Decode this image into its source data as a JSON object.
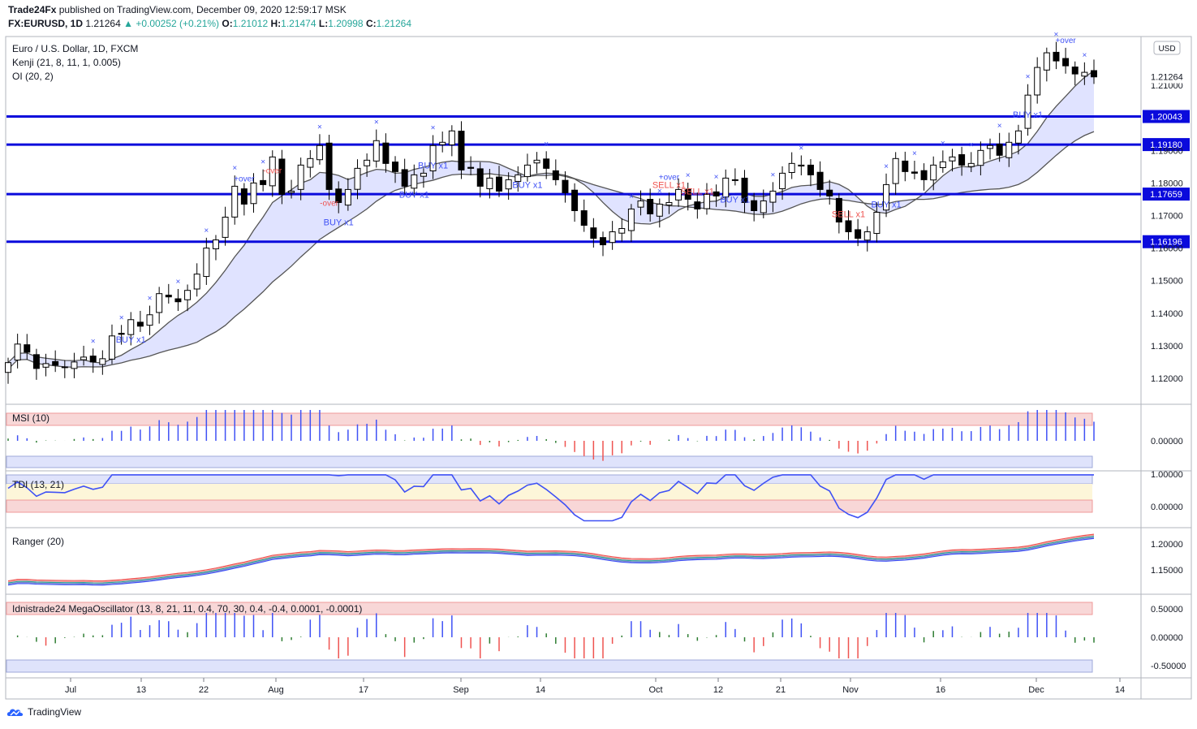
{
  "header": {
    "publisher": "Trade24Fx",
    "published_text": "published on TradingView.com, December 09, 2020 12:59:17 MSK",
    "symbol": "FX:EURUSD, 1D",
    "price": "1.21264",
    "change": "+0.00252 (+0.21%)",
    "open_label": "O:",
    "open": "1.21012",
    "high_label": "H:",
    "high": "1.21474",
    "low_label": "L:",
    "low": "1.20998",
    "close_label": "C:",
    "close": "1.21264"
  },
  "legend": {
    "title": "Euro / U.S. Dollar, 1D, FXCM",
    "line2": "Kenji (21, 8, 11, 1, 0.005)",
    "line3": "OI (20, 2)"
  },
  "footer": {
    "brand": "TradingView"
  },
  "colors": {
    "bull": "#ffffff",
    "bear": "#000000",
    "hline": "#0a0adc",
    "cloud_up": "#dff3d6",
    "cloud_dn": "#f7dede",
    "band": "#d8dcff",
    "signal_blue": "#3f51f5",
    "signal_red": "#ef5350"
  },
  "chart_data": [
    {
      "type": "candlestick",
      "title": "Euro / U.S. Dollar, 1D, FXCM",
      "currency": "USD",
      "ylim": [
        1.112,
        1.225
      ],
      "yticks": [
        "1.12000",
        "1.13000",
        "1.14000",
        "1.15000",
        "1.16000",
        "1.17000",
        "1.18000",
        "1.19000",
        "1.21000"
      ],
      "x_tick_labels": [
        "Jul",
        "13",
        "22",
        "Aug",
        "17",
        "Sep",
        "14",
        "Oct",
        "12",
        "21",
        "Nov",
        "16",
        "Dec",
        "14"
      ],
      "levels": [
        {
          "value": 1.20043,
          "label": "1.20043"
        },
        {
          "value": 1.1918,
          "label": "1.19180"
        },
        {
          "value": 1.17659,
          "label": "1.17659"
        },
        {
          "value": 1.16196,
          "label": "1.16196"
        }
      ],
      "last_price": "1.21264",
      "closes": [
        1.1248,
        1.1305,
        1.128,
        1.123,
        1.1245,
        1.124,
        1.1235,
        1.125,
        1.1265,
        1.125,
        1.126,
        1.133,
        1.1335,
        1.138,
        1.136,
        1.1395,
        1.146,
        1.145,
        1.1435,
        1.147,
        1.152,
        1.16,
        1.1625,
        1.1695,
        1.179,
        1.1735,
        1.18,
        1.1795,
        1.188,
        1.1765,
        1.1775,
        1.1855,
        1.1875,
        1.1915,
        1.178,
        1.174,
        1.178,
        1.1845,
        1.187,
        1.193,
        1.186,
        1.1835,
        1.179,
        1.1825,
        1.183,
        1.1915,
        1.1925,
        1.196,
        1.184,
        1.1845,
        1.179,
        1.1815,
        1.1775,
        1.181,
        1.1825,
        1.1855,
        1.187,
        1.1845,
        1.181,
        1.177,
        1.1715,
        1.167,
        1.163,
        1.161,
        1.165,
        1.166,
        1.172,
        1.1745,
        1.1705,
        1.1735,
        1.174,
        1.178,
        1.175,
        1.172,
        1.1765,
        1.176,
        1.1815,
        1.181,
        1.174,
        1.1715,
        1.1745,
        1.1775,
        1.183,
        1.186,
        1.1855,
        1.1825,
        1.178,
        1.176,
        1.168,
        1.165,
        1.163,
        1.165,
        1.171,
        1.1795,
        1.1875,
        1.1835,
        1.183,
        1.181,
        1.1855,
        1.1865,
        1.188,
        1.1855,
        1.186,
        1.19,
        1.1915,
        1.1885,
        1.1925,
        1.196,
        1.207,
        1.2155,
        1.22,
        1.2175,
        1.216,
        1.2135,
        1.214,
        1.2126
      ],
      "buy_signals": [
        "BUY x1",
        "BUY x1",
        "BUY x1",
        "BUY x1",
        "BUY x1",
        "BUY x1",
        "BUY x1",
        "BUY x1"
      ],
      "sell_signals": [
        "SELL x1",
        "SELL x1",
        "SELL x1"
      ],
      "over_labels": [
        "+over",
        "-over",
        "-over",
        "+over",
        "+over"
      ]
    },
    {
      "type": "bar",
      "title": "MSI (10)",
      "yticks": [
        "0.00000"
      ],
      "values_description": "histogram"
    },
    {
      "type": "line",
      "title": "TDI (13, 21)",
      "yticks": [
        "1.00000",
        "0.00000"
      ]
    },
    {
      "type": "line",
      "title": "Ranger (20)",
      "yticks": [
        "1.20000",
        "1.15000"
      ]
    },
    {
      "type": "bar",
      "title": "Idnistrade24 MegaOscillator (13, 8, 21, 11, 0.4, 70, 30, 0.4, -0.4, 0.0001, -0.0001)",
      "yticks": [
        "0.50000",
        "0.00000",
        "-0.50000"
      ]
    }
  ]
}
